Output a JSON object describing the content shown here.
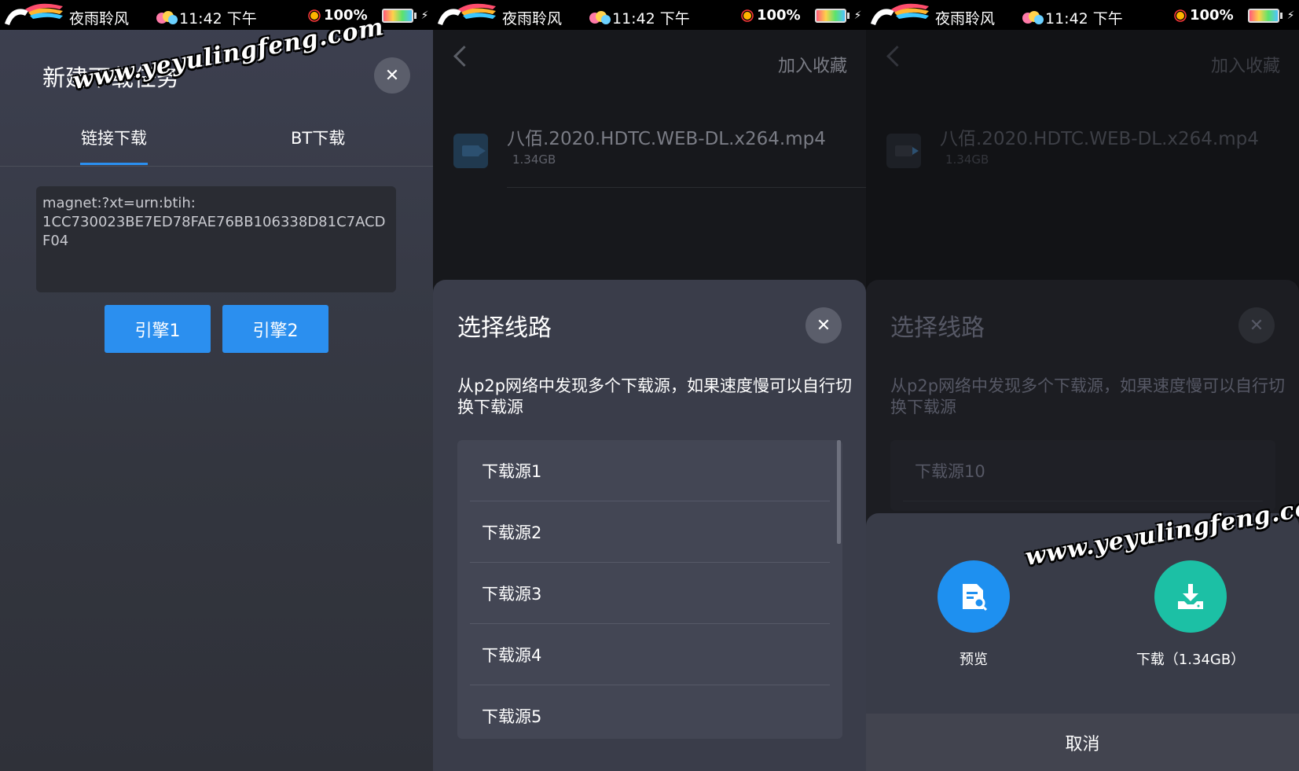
{
  "status_bar": {
    "carrier": "夜雨聆风",
    "time": "11:42 下午",
    "battery": "100%"
  },
  "new_task": {
    "title": "新建下载任务",
    "tabs": [
      "链接下载",
      "BT下载"
    ],
    "magnet_text": "magnet:?xt=urn:btih:\n1CC730023BE7ED78FAE76BB106338D81C7ACDF04",
    "engine_buttons": [
      "引擎1",
      "引擎2"
    ],
    "close_glyph": "✕"
  },
  "file": {
    "favorite_label": "加入收藏",
    "name": "八佰.2020.HDTC.WEB-DL.x264.mp4",
    "size": "1.34GB"
  },
  "route_sheet": {
    "title": "选择线路",
    "description": "从p2p网络中发现多个下载源，如果速度慢可以自行切换下载源",
    "sources": [
      "下载源1",
      "下载源2",
      "下载源3",
      "下载源4",
      "下载源5"
    ],
    "visible_source_behind": "下载源10"
  },
  "actions": {
    "preview_label": "预览",
    "download_label": "下载（1.34GB）",
    "cancel_label": "取消"
  },
  "watermark": {
    "text": "www.yeyulingfeng.com"
  },
  "colors": {
    "accent_blue": "#2b8fef",
    "preview_blue": "#1e90f0",
    "download_teal": "#1cc0a5"
  }
}
